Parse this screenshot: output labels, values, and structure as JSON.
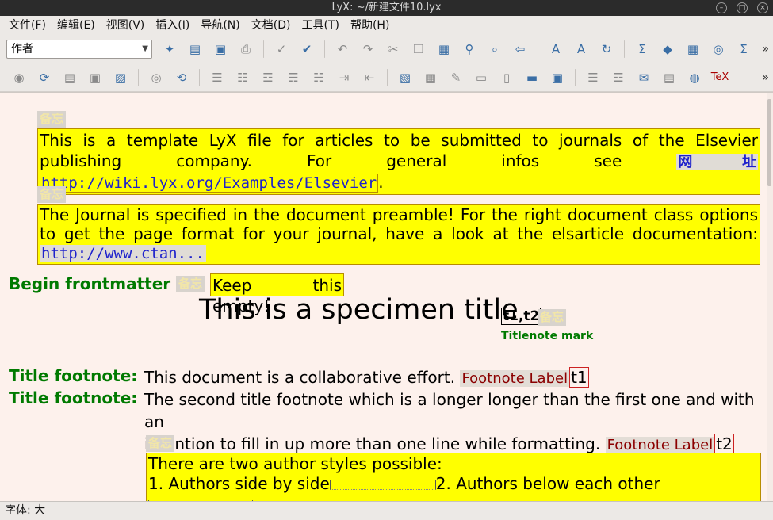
{
  "window": {
    "title": "LyX: ~/新建文件10.lyx"
  },
  "menu": [
    "文件(F)",
    "编辑(E)",
    "视图(V)",
    "插入(I)",
    "导航(N)",
    "文档(D)",
    "工具(T)",
    "帮助(H)"
  ],
  "toolbar": {
    "style_selector": "作者",
    "icons1": [
      "new-file-icon",
      "open-icon",
      "save-icon",
      "print-icon",
      "spellcheck-icon",
      "spellcheck-continuous-icon",
      "undo-icon",
      "redo-icon",
      "cut-icon",
      "copy-icon",
      "paste-icon",
      "find-icon",
      "find-replace-icon",
      "navigate-back-icon",
      "text-style-icon",
      "font-icon",
      "change-tracking-icon",
      "math-icon",
      "figure-icon",
      "table-icon",
      "compass-icon",
      "sigma-icon"
    ],
    "icons2": [
      "view-icon",
      "update-icon",
      "view-master-icon",
      "update-master-icon",
      "export-icon",
      "view-other-icon",
      "update-other-icon",
      "list-icon",
      "numbered-list-icon",
      "description-icon",
      "enumerate-icon",
      "outline-icon",
      "indent-icon",
      "outdent-icon",
      "insert-graphics-icon",
      "insert-table-icon",
      "attach-icon",
      "insert-ref-icon",
      "insert-cite-icon",
      "insert-label-icon",
      "insert-box-icon",
      "insert-box2-icon",
      "toc-icon",
      "note-icon",
      "ert-icon",
      "web-icon",
      "tex-icon"
    ]
  },
  "document": {
    "note_label": "备忘",
    "note1_text_a": "This is a template LyX file for articles to be submitted to journals of the Elsevier publishing company. For general infos see ",
    "web_label": "网址",
    "note1_url": "http://wiki.lyx.org/Examples/Elsevier",
    "note1_end": ".",
    "note2_text": "The Journal is specified in the document preamble! For the right document class options to get the page format for your journal, have a look at the elsarticle documentation: ",
    "note2_url": "http://www.ctan...",
    "begin_frontmatter": "Begin frontmatter",
    "keep_empty": "Keep this empty!",
    "title": "This is a specimen title",
    "title_mark": "t1,t2",
    "titlenote_caption": "Titlenote mark",
    "title_footnote_label": "Title footnote:",
    "footnote1_text": "This document is a collaborative effort.",
    "footnote_label": "Footnote Label",
    "footnote1_ref": "t1",
    "footnote2_line1": "The second title footnote which is a longer longer than the first one and with an",
    "footnote2_line2": "intention to fill in up more than one line while formatting.",
    "footnote2_ref": "t2",
    "note3_line1": "There are two author styles possible:",
    "note3_line2a": "1. Authors side by side",
    "note3_line2b": "2. Authors below each other"
  },
  "status": {
    "text": "字体: 大"
  }
}
